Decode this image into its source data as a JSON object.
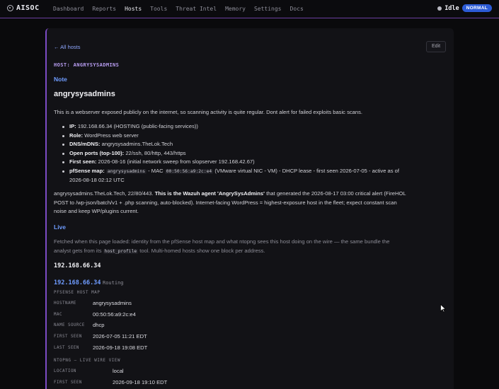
{
  "app": {
    "logo_text": "AISOC"
  },
  "nav": {
    "items": [
      "Dashboard",
      "Reports",
      "Hosts",
      "Tools",
      "Threat Intel",
      "Memory",
      "Settings",
      "Docs"
    ],
    "active": "Hosts"
  },
  "status": {
    "label": "Idle",
    "mode": "NORMAL"
  },
  "page": {
    "back_link": "← All hosts",
    "edit_label": "Edit",
    "host_label": "HOST: ANGRYSYSADMINS"
  },
  "note": {
    "section_title": "Note",
    "name": "angrysysadmins",
    "intro": "This is a webserver exposed publicly on the internet, so scanning activity is quite regular. Dont alert for failed exploits basic scans.",
    "bullets": [
      {
        "key": "IP:",
        "value": "192.168.66.34 (HOSTING (public-facing services))"
      },
      {
        "key": "Role:",
        "value": "WordPress web server"
      },
      {
        "key": "DNS/mDNS:",
        "value": "angrysysadmins.TheLok.Tech"
      },
      {
        "key": "Open ports (top-100):",
        "value": "22/ssh, 80/http, 443/https"
      },
      {
        "key": "First seen:",
        "value": "2026-08-16 (initial network sweep from slopserver 192.168.42.67)"
      }
    ],
    "pfsense": {
      "key": "pfSense map:",
      "hostname_code": "angrysysadmins",
      "mid1": "- MAC",
      "mac_code": "00:50:56:a9:2c:e4",
      "rest": "(VMware virtual NIC - VM) - DHCP lease - first seen 2026-07-05 - active as of",
      "line2": "2026-08-18 02:12 UTC"
    },
    "summary_pre": "angrysysadmins.TheLok.Tech, 22/80/443.",
    "summary_bold": "This is the Wazuh agent 'AngrySysAdmins'",
    "summary_post": "that generated the 2026-08-17 03:00 critical alert (FireHOL",
    "summary_line2": "POST to /wp-json/batch/v1 + .php scanning, auto-blocked). Internet-facing WordPress = highest-exposure host in the fleet; expect constant scan",
    "summary_line3": "noise and keep WP/plugins current."
  },
  "live": {
    "section_title": "Live",
    "desc_line1": "Fetched when this page loaded: identity from the pfSense host map and what ntopng sees this host doing on the wire — the same bundle the",
    "desc_pre": "analyst gets from its",
    "desc_code": "host_profile",
    "desc_post": "tool. Multi-homed hosts show one block per address.",
    "ip": "192.168.66.34",
    "ip_link": "192.168.66.34",
    "ip_tag": "Routing",
    "pfsense_head": "PFSENSE HOST MAP",
    "pfsense_rows": [
      {
        "key": "HOSTNAME",
        "value": "angrysysadmins"
      },
      {
        "key": "MAC",
        "value": "00:50:56:a9:2c:e4"
      },
      {
        "key": "NAME SOURCE",
        "value": "dhcp"
      },
      {
        "key": "FIRST SEEN",
        "value": "2026-07-05 11:21 EDT"
      },
      {
        "key": "LAST SEEN",
        "value": "2026-09-18 19:08 EDT"
      }
    ],
    "ntop_head": "NTOPNG — LIVE WIRE VIEW",
    "ntop_rows": [
      {
        "key": "LOCATION",
        "value": "local"
      },
      {
        "key": "FIRST SEEN",
        "value": "2026-09-18 19:10 EDT"
      }
    ]
  },
  "colors": {
    "accent": "#6f9cff",
    "border": "#7c4bc4",
    "badge": "#2c5bd6"
  }
}
